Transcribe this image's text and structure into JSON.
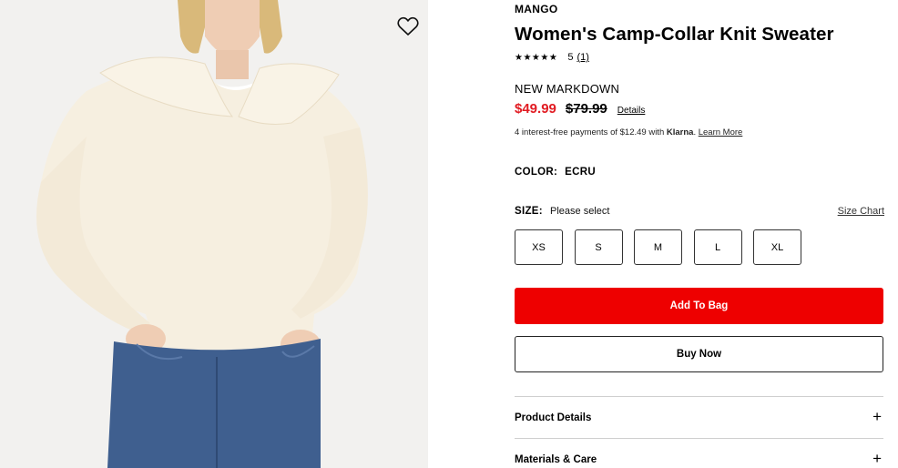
{
  "product": {
    "brand": "MANGO",
    "title": "Women's Camp-Collar Knit Sweater",
    "rating": {
      "stars": "★★★★★",
      "score": "5",
      "count": "(1)"
    },
    "markdown_label": "NEW MARKDOWN",
    "price": {
      "sale": "$49.99",
      "original": "$79.99",
      "details_link": "Details"
    },
    "klarna": {
      "text": "4 interest-free payments of $12.49 with ",
      "brand": "Klarna",
      "learn_more": "Learn More"
    },
    "color": {
      "label": "COLOR:",
      "value": "ECRU"
    },
    "size": {
      "label": "SIZE:",
      "prompt": "Please select",
      "chart_link": "Size Chart",
      "options": [
        "XS",
        "S",
        "M",
        "L",
        "XL"
      ]
    },
    "actions": {
      "add_to_bag": "Add To Bag",
      "buy_now": "Buy Now"
    },
    "accordions": [
      {
        "label": "Product Details",
        "icon": "+"
      },
      {
        "label": "Materials & Care",
        "icon": "+"
      }
    ]
  },
  "colors": {
    "sale_red": "#e11b22",
    "button_red": "#ee0000",
    "sweater": "#f6efe0",
    "denim": "#3f5f8f"
  },
  "icons": {
    "wishlist": "heart-icon",
    "expand": "plus-icon"
  }
}
